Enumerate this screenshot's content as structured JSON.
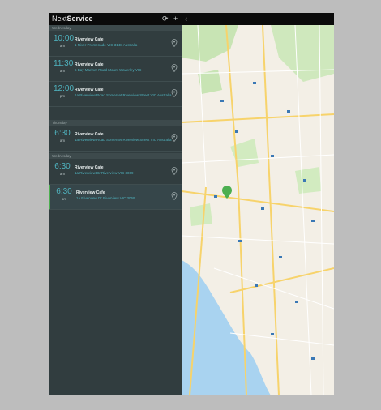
{
  "app": {
    "brand_light": "Next",
    "brand_bold": "Service"
  },
  "toolbar": {
    "refresh_icon": "⟳",
    "add_icon": "+",
    "back_icon": "‹"
  },
  "groups": [
    "Wednesday",
    "Thursday",
    "Wednesday"
  ],
  "appointments": [
    {
      "time": "10:00",
      "ampm": "am",
      "title": "Riverview Cafe",
      "address": "1 River Promenade VIC 3148 Australia",
      "selected": false
    },
    {
      "time": "11:30",
      "ampm": "am",
      "title": "Riverview Cafe",
      "address": "6 Bay Mariner Road Mount Waverley VIC",
      "selected": false
    },
    {
      "time": "12:00",
      "ampm": "pm",
      "title": "Riverview Cafe",
      "address": "1a Riverview Road Somerset Riverview Street VIC Australia",
      "selected": false
    },
    {
      "time": "6:30",
      "ampm": "am",
      "title": "Riverview Cafe",
      "address": "1a Riverview Road Somerset Riverview Street VIC Australia",
      "selected": false
    },
    {
      "time": "6:30",
      "ampm": "am",
      "title": "Riverview Cafe",
      "address": "1a Riverview Dr Riverview VIC 3069",
      "selected": false
    },
    {
      "time": "6:30",
      "ampm": "am",
      "title": "Riverview Cafe",
      "address": "1a Riverview Dr Riverview VIC 3069",
      "selected": true
    }
  ],
  "colors": {
    "accent": "#4fb3bf",
    "selected": "#4caf50",
    "panel": "#313d3f",
    "water": "#a9d3f0",
    "park": "#c8e4b4"
  }
}
